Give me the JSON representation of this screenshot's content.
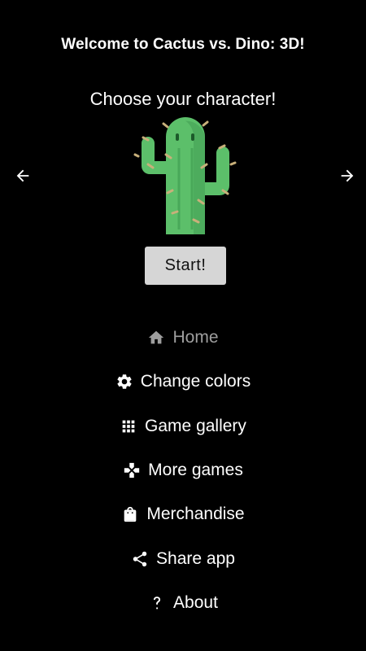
{
  "header": {
    "title": "Welcome to Cactus vs. Dino: 3D!",
    "subtitle": "Choose your character!"
  },
  "selector": {
    "prev_icon": "arrow-left-icon",
    "next_icon": "arrow-right-icon",
    "character": "cactus"
  },
  "start_label": "Start!",
  "menu": [
    {
      "label": "Home",
      "icon": "home-icon",
      "active": true
    },
    {
      "label": "Change colors",
      "icon": "gear-icon"
    },
    {
      "label": "Game gallery",
      "icon": "grid-icon"
    },
    {
      "label": "More games",
      "icon": "gamepad-icon"
    },
    {
      "label": "Merchandise",
      "icon": "shopping-bag-icon"
    },
    {
      "label": "Share app",
      "icon": "share-icon"
    },
    {
      "label": "About",
      "icon": "question-icon"
    }
  ],
  "colors": {
    "background": "#000000",
    "text": "#ffffff",
    "active_menu": "#9e9e9e",
    "button_bg": "#d6d6d6",
    "cactus": "#5cbf6a"
  }
}
